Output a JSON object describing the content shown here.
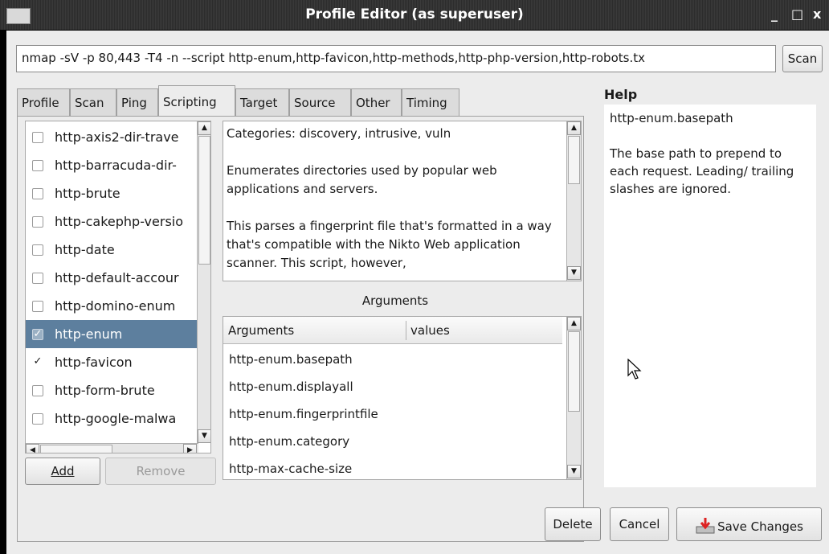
{
  "window": {
    "title": "Profile Editor (as superuser)",
    "controls": [
      "_",
      "□",
      "x"
    ]
  },
  "command": {
    "value": "nmap -sV -p 80,443 -T4 -n --script http-enum,http-favicon,http-methods,http-php-version,http-robots.tx",
    "scan_label": "Scan"
  },
  "tabs": [
    "Profile",
    "Scan",
    "Ping",
    "Scripting",
    "Target",
    "Source",
    "Other",
    "Timing"
  ],
  "active_tab": "Scripting",
  "scripts": [
    {
      "name": "http-axis2-dir-trave",
      "checked": false
    },
    {
      "name": "http-barracuda-dir-",
      "checked": false
    },
    {
      "name": "http-brute",
      "checked": false
    },
    {
      "name": "http-cakephp-versio",
      "checked": false
    },
    {
      "name": "http-date",
      "checked": false
    },
    {
      "name": "http-default-accour",
      "checked": false
    },
    {
      "name": "http-domino-enum",
      "checked": false
    },
    {
      "name": "http-enum",
      "checked": true,
      "selected": true
    },
    {
      "name": "http-favicon",
      "checked": true
    },
    {
      "name": "http-form-brute",
      "checked": false
    },
    {
      "name": "http-google-malwa",
      "checked": false
    }
  ],
  "script_buttons": {
    "add": "Add",
    "remove": "Remove"
  },
  "description": {
    "categories": "Categories: discovery, intrusive, vuln",
    "para1": "Enumerates directories used by popular web applications and servers.",
    "para2": "This parses a fingerprint file that's formatted in a way that's compatible with the Nikto Web application scanner. This script, however,"
  },
  "arguments": {
    "label": "Arguments",
    "columns": [
      "Arguments",
      "values"
    ],
    "rows": [
      "http-enum.basepath",
      "http-enum.displayall",
      "http-enum.fingerprintfile",
      "http-enum.category",
      "http-max-cache-size"
    ]
  },
  "help": {
    "title": "Help",
    "arg": "http-enum.basepath",
    "text": "The base path to prepend to each request. Leading/ trailing slashes are ignored."
  },
  "footer": {
    "delete": "Delete",
    "cancel": "Cancel",
    "save": "Save Changes"
  }
}
